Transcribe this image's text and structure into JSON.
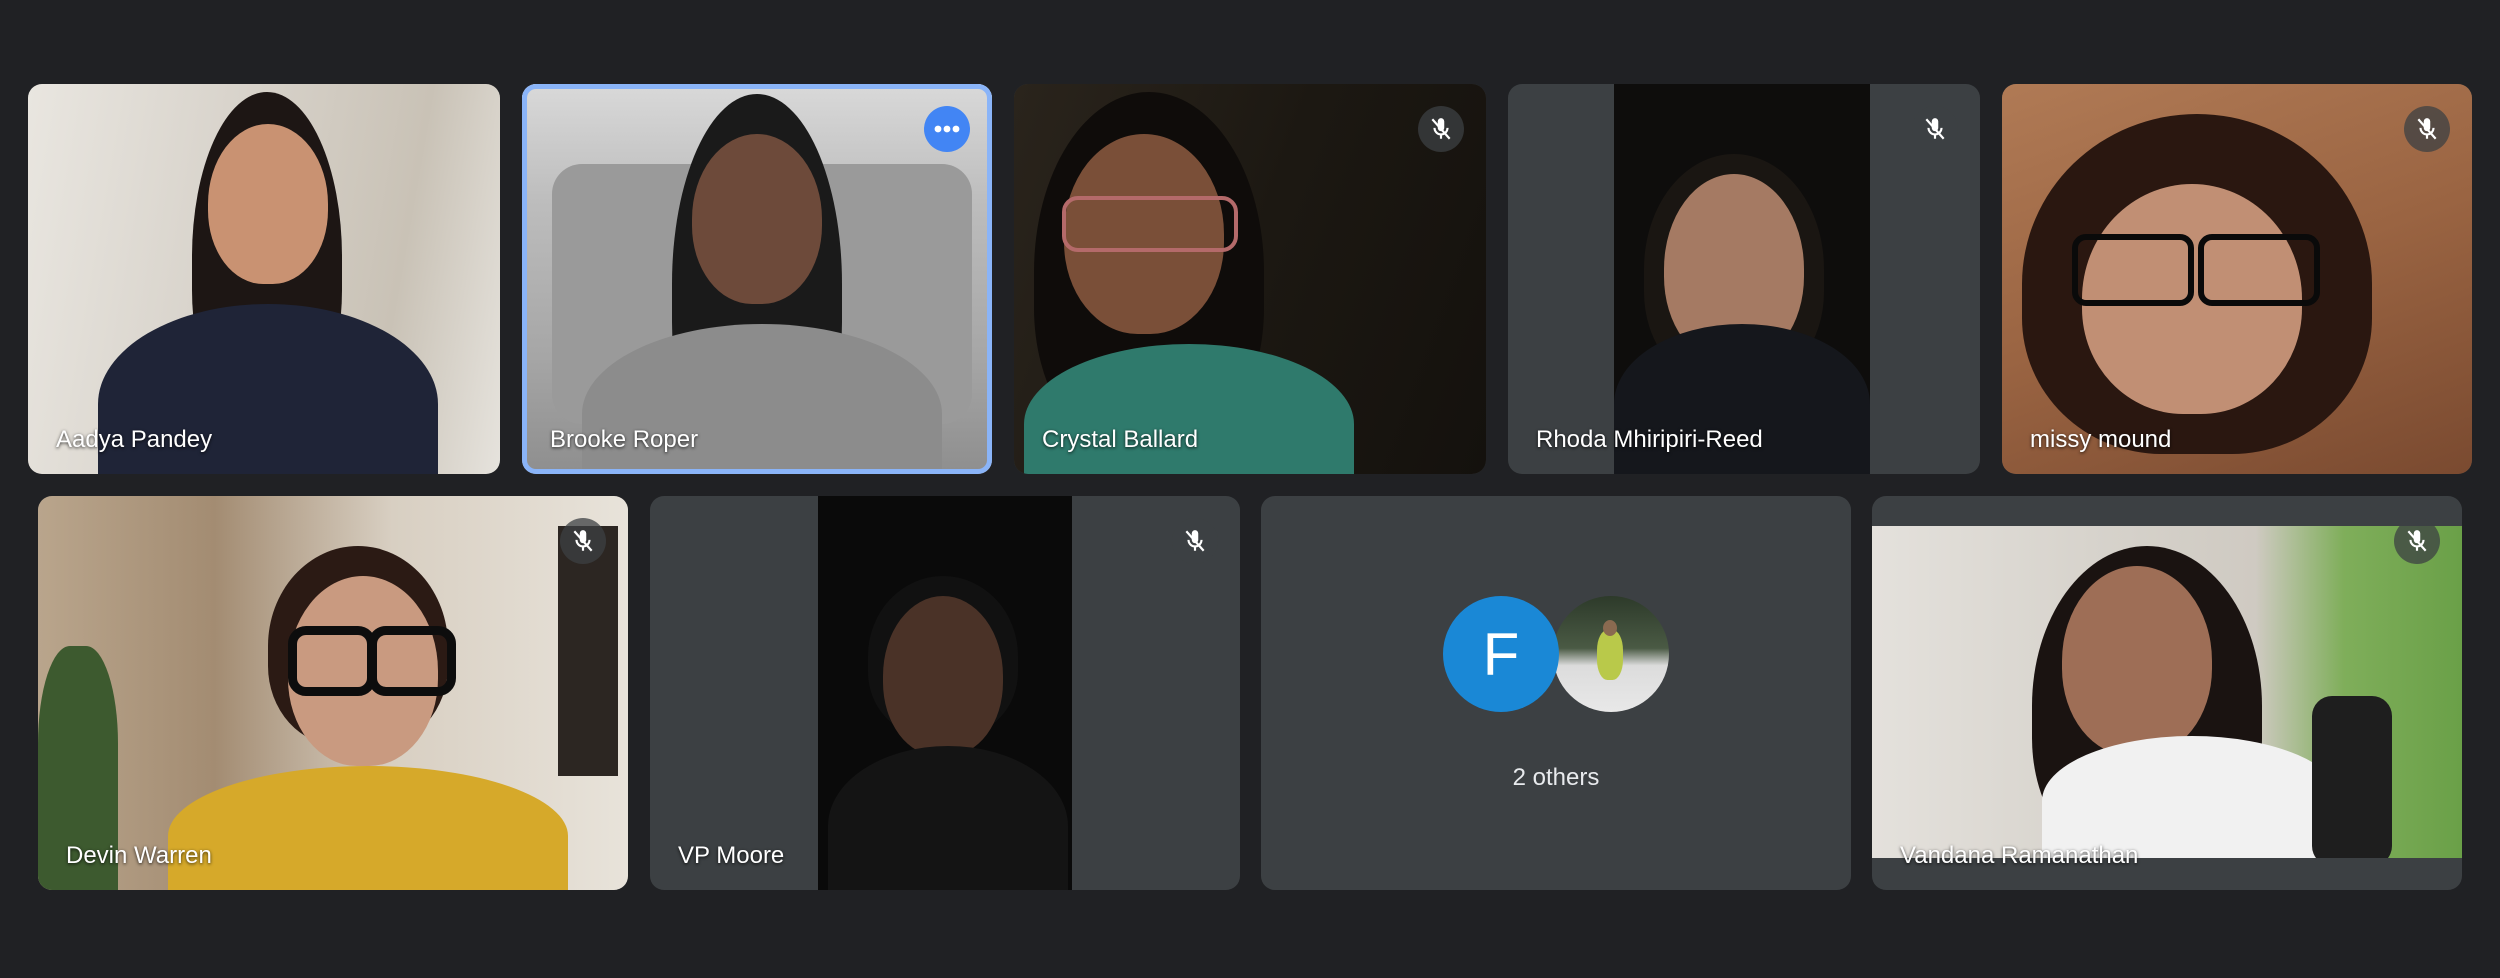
{
  "participants": [
    {
      "name": "Aadya Pandey",
      "muted": false
    },
    {
      "name": "Brooke Roper",
      "muted": false,
      "active_speaker": true
    },
    {
      "name": "Crystal Ballard",
      "muted": true
    },
    {
      "name": "Rhoda Mhiripiri-Reed",
      "muted": true
    },
    {
      "name": "missy mound",
      "muted": true
    },
    {
      "name": "Devin Warren",
      "muted": true
    },
    {
      "name": "VP Moore",
      "muted": true
    },
    {
      "name": "Vandana Ramanathan",
      "muted": true
    }
  ],
  "others_tile": {
    "avatar_letter": "F",
    "label": "2 others"
  },
  "icons": {
    "mute": "mic-off-icon",
    "more": "more-options-icon"
  },
  "colors": {
    "background": "#202124",
    "tile": "#3c4043",
    "active_border": "#8ab4f8",
    "more_button": "#4285f4",
    "avatar_f": "#1a88d6"
  }
}
